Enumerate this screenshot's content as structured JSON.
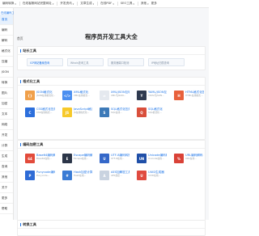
{
  "topnav": {
    "items": [
      {
        "label": "编码转换",
        "caret": "▾"
      },
      {
        "label": "在线客服网站完整网址",
        "caret": "▾"
      },
      {
        "label": "开发资讯",
        "caret": "▾"
      },
      {
        "label": "文章生成",
        "caret": "▾"
      },
      {
        "label": "在线PDF",
        "caret": "▾"
      },
      {
        "label": "SEO工具",
        "caret": "▾"
      },
      {
        "label": "其他",
        "caret": "▾"
      }
    ],
    "more": "更多"
  },
  "sidebar": {
    "brand": "在线编码工具网",
    "items": [
      {
        "label": "首页"
      },
      {
        "label": "编码"
      },
      {
        "label": "解码"
      },
      {
        "label": "格式化"
      },
      {
        "label": "压缩"
      },
      {
        "label": "JSON"
      },
      {
        "label": "转换"
      },
      {
        "label": "图片"
      },
      {
        "label": "加密"
      },
      {
        "label": "文本"
      },
      {
        "label": "网络"
      },
      {
        "label": "开发"
      },
      {
        "label": "计算"
      },
      {
        "label": "生成"
      },
      {
        "label": "查询"
      },
      {
        "label": "其他"
      },
      {
        "label": "关于"
      },
      {
        "label": "更多"
      },
      {
        "label": "帮助"
      }
    ]
  },
  "main": {
    "crumb": "首页",
    "title": "程序员开发工具大全"
  },
  "sections": {
    "links": {
      "title": "站长工具",
      "chips": [
        {
          "label": "ICP网站备案查询",
          "muted": false
        },
        {
          "label": "Whois查询工具",
          "muted": true
        },
        {
          "label": "服务器端口检测",
          "muted": true
        },
        {
          "label": "IP地址归属查询",
          "muted": true
        }
      ]
    },
    "format": {
      "title": "格式化工具",
      "cards": [
        {
          "title": "JSON格式化",
          "desc": "JSON在线格式化...",
          "icon": "{}",
          "color": "#f0a04b"
        },
        {
          "title": "XML格式化",
          "desc": "XML在线格式...",
          "icon": "</>",
          "color": "#4b8ff0"
        },
        {
          "title": "XML/JSON互转",
          "desc": "XML与JSON...",
          "icon": "⇄",
          "color": "#e5e9ef"
        },
        {
          "title": "YAML/JSON互转",
          "desc": "YAML与JSON...",
          "icon": "Y",
          "color": "#2f3a4f"
        },
        {
          "title": "HTML格式化压缩",
          "desc": "HTML在线格式...",
          "icon": "H",
          "color": "#e8613c"
        },
        {
          "title": "CSS格式化压缩",
          "desc": "CSS在线格式...",
          "icon": "C",
          "color": "#2c6fdc"
        },
        {
          "title": "JavaScript格式化",
          "desc": "JS在线格式化...",
          "icon": "JS",
          "color": "#f7c92a"
        },
        {
          "title": "SQL格式化压缩",
          "desc": "SQL在线...",
          "icon": "S",
          "color": "#3d7ab8"
        },
        {
          "title": "SQL格式化",
          "desc": "SQL格式化...",
          "icon": "Q",
          "color": "#d94f3b"
        }
      ]
    },
    "encode": {
      "title": "编码加密工具",
      "cards": [
        {
          "title": "Base64编码解码",
          "desc": "Base64在线...",
          "icon": "64",
          "color": "#e24b3b"
        },
        {
          "title": "Escape编码解码",
          "desc": "Escape在线...",
          "icon": "E",
          "color": "#2b3548"
        },
        {
          "title": "UTF-8编码转换",
          "desc": "UTF-8在线...",
          "icon": "U",
          "color": "#3568c9"
        },
        {
          "title": "Unicode编码转换",
          "desc": "Unicode在线...",
          "icon": "UN",
          "color": "#1f4fa8"
        },
        {
          "title": "URL编码解码",
          "desc": "URL在线...",
          "icon": "%",
          "color": "#d94237"
        },
        {
          "title": "Punycode编码",
          "desc": "Punycode...",
          "icon": "P",
          "color": "#2e6bd6"
        },
        {
          "title": "Hash加密计算",
          "desc": "Hash在线...",
          "icon": "#",
          "color": "#3a7bd5"
        },
        {
          "title": "AES加解密工具",
          "desc": "AES加密...",
          "icon": "A",
          "color": "#c9d3e0"
        },
        {
          "title": "UUID生成器",
          "desc": "UUID在线...",
          "icon": "U",
          "color": "#e04a3f"
        }
      ]
    },
    "convert": {
      "title": "转换工具"
    }
  }
}
